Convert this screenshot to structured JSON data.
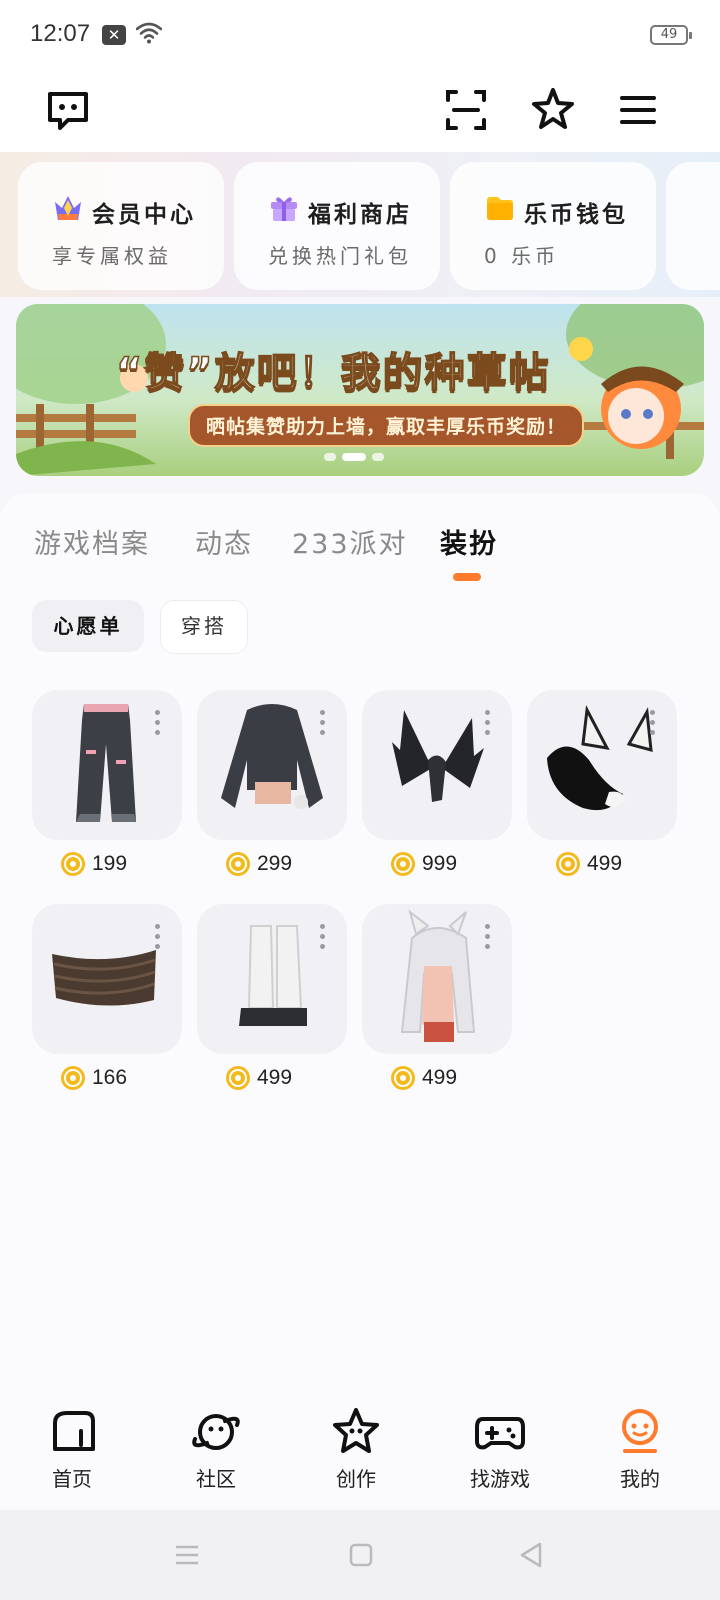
{
  "status_bar": {
    "time": "12:07",
    "battery": "49"
  },
  "quick_cards": [
    {
      "title": "会员中心",
      "subtitle": "享专属权益",
      "icon": "crown-icon"
    },
    {
      "title": "福利商店",
      "subtitle": "兑换热门礼包",
      "icon": "gift-icon"
    },
    {
      "title": "乐币钱包",
      "subtitle": "0 乐币",
      "icon": "wallet-icon"
    }
  ],
  "banner": {
    "title": "“赞”放吧！我的种草帖",
    "subtitle": "晒帖集赞助力上墙，赢取丰厚乐币奖励！"
  },
  "tabs": [
    {
      "label": "游戏档案",
      "active": false
    },
    {
      "label": "动态",
      "active": false
    },
    {
      "label": "233派对",
      "active": false
    },
    {
      "label": "装扮",
      "active": true
    }
  ],
  "chips": [
    {
      "label": "心愿单",
      "selected": true
    },
    {
      "label": "穿搭",
      "selected": false
    }
  ],
  "items": [
    {
      "name": "jeans",
      "price": "199"
    },
    {
      "name": "cropped-hoodie",
      "price": "299"
    },
    {
      "name": "dragon-wings",
      "price": "999"
    },
    {
      "name": "fox-ears-tail",
      "price": "499"
    },
    {
      "name": "headband",
      "price": "166"
    },
    {
      "name": "leg-warmers",
      "price": "499"
    },
    {
      "name": "white-hair-ears",
      "price": "499"
    }
  ],
  "bottom_nav": [
    {
      "label": "首页",
      "icon": "home-icon"
    },
    {
      "label": "社区",
      "icon": "community-planet-icon"
    },
    {
      "label": "创作",
      "icon": "create-star-icon"
    },
    {
      "label": "找游戏",
      "icon": "gamepad-icon"
    },
    {
      "label": "我的",
      "icon": "profile-icon",
      "active": true
    }
  ],
  "colors": {
    "accent": "#ff7a2b",
    "coin": "#f4b91c"
  }
}
